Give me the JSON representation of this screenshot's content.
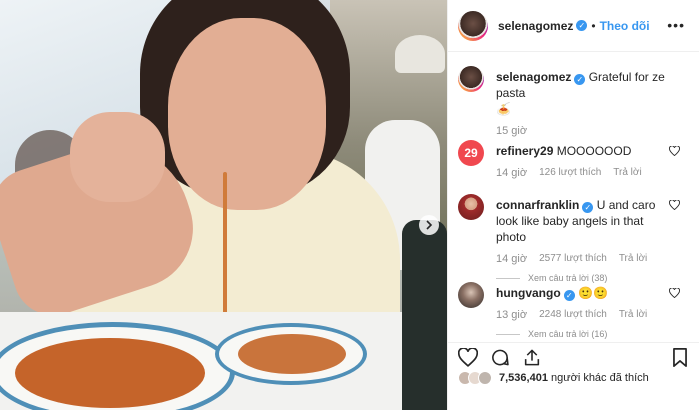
{
  "post": {
    "author": "selenagomez",
    "follow_label": "Theo dõi",
    "separator": "•",
    "more_label": "•••",
    "caption_author": "selenagomez",
    "caption_text": "Grateful for ze pasta",
    "caption_emoji": "🍝",
    "caption_time": "15 giờ"
  },
  "comments": [
    {
      "user": "refinery29",
      "verified": false,
      "text": "MOOOOOOD",
      "time": "14 giờ",
      "likes": "126 lượt thích",
      "reply": "Trả lời",
      "view_replies": ""
    },
    {
      "user": "connarfranklin",
      "verified": true,
      "text": "U and caro look like baby angels in that photo",
      "time": "14 giờ",
      "likes": "2577 lượt thích",
      "reply": "Trả lời",
      "view_replies": "Xem câu trả lời (38)"
    },
    {
      "user": "hungvango",
      "verified": true,
      "text": "🙂🙂",
      "time": "13 giờ",
      "likes": "2248 lượt thích",
      "reply": "Trả lời",
      "view_replies": "Xem câu trả lời (16)"
    }
  ],
  "actions": {
    "likes_count": "7,536,401",
    "likes_suffix": "người khác đã thích"
  },
  "colors": {
    "accent": "#3897f0",
    "text": "#262626",
    "muted": "#8e8e8e",
    "refinery_red": "#f0484f"
  },
  "icons": [
    "verified-badge-icon",
    "heart-icon",
    "comment-icon",
    "share-icon",
    "bookmark-icon",
    "chevron-right-icon",
    "more-options-icon"
  ]
}
